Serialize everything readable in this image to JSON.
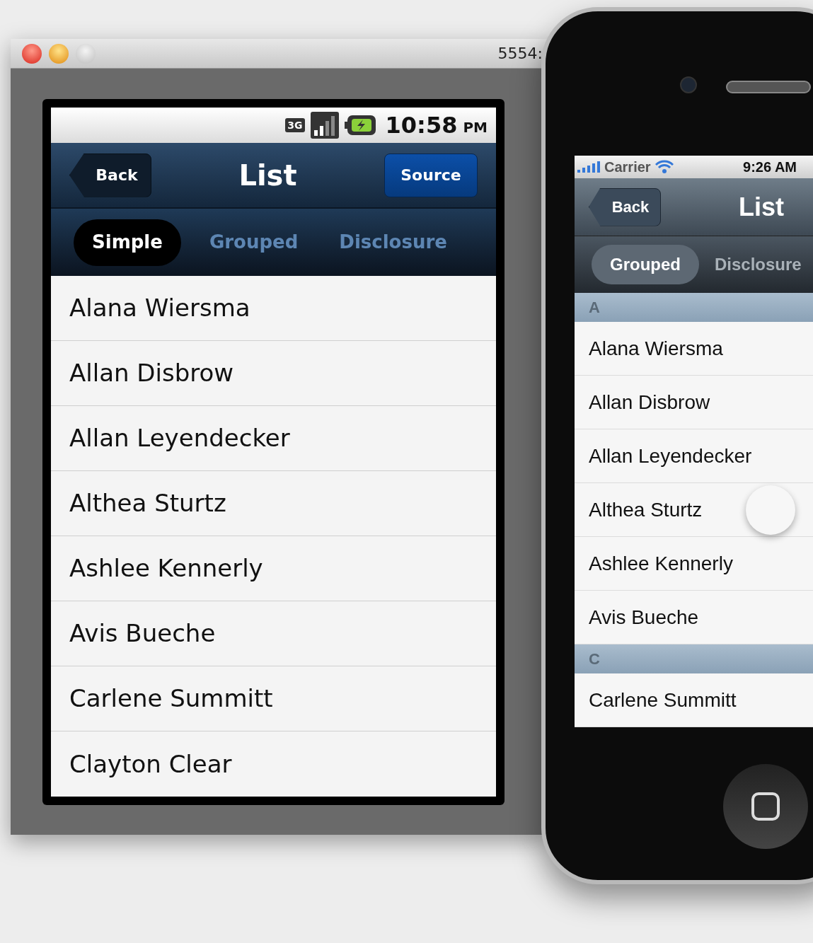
{
  "android": {
    "window": {
      "title": "5554:"
    },
    "status_bar": {
      "network": "3G",
      "time": "10:58",
      "ampm": "PM"
    },
    "nav": {
      "back": "Back",
      "title": "List",
      "action": "Source"
    },
    "tabs": [
      {
        "label": "Simple",
        "selected": true
      },
      {
        "label": "Grouped",
        "selected": false
      },
      {
        "label": "Disclosure",
        "selected": false
      }
    ],
    "rows": [
      "Alana Wiersma",
      "Allan Disbrow",
      "Allan Leyendecker",
      "Althea Sturtz",
      "Ashlee Kennerly",
      "Avis Bueche",
      "Carlene Summitt",
      "Clayton Clear"
    ]
  },
  "iphone": {
    "status_bar": {
      "carrier": "Carrier",
      "time": "9:26 AM"
    },
    "nav": {
      "back": "Back",
      "title": "List"
    },
    "tabs": [
      {
        "label": "Grouped",
        "selected": true
      },
      {
        "label": "Disclosure",
        "selected": false
      }
    ],
    "sections": [
      {
        "header": "A",
        "rows": [
          "Alana Wiersma",
          "Allan Disbrow",
          "Allan Leyendecker",
          "Althea Sturtz",
          "Ashlee Kennerly",
          "Avis Bueche"
        ]
      },
      {
        "header": "C",
        "rows": [
          "Carlene Summitt"
        ]
      }
    ]
  }
}
